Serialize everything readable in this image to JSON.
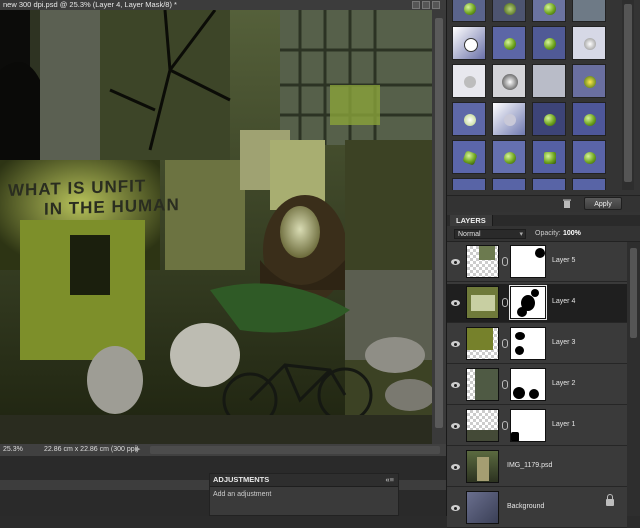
{
  "document": {
    "title": "new 300 dpi.psd @ 25.3% (Layer 4, Layer Mask/8) *",
    "zoom": "25.3%",
    "doc_size": "22.86 cm x 22.86 cm (300 ppi)",
    "canvas_text_line1": "WHAT IS UNFIT",
    "canvas_text_line2": "IN THE HUMAN"
  },
  "effects_panel": {
    "apply_label": "Apply",
    "trash_icon": "trash-icon"
  },
  "adjustments_panel": {
    "title": "ADJUSTMENTS",
    "hint": "Add an adjustment"
  },
  "layers_panel": {
    "tab_label": "LAYERS",
    "blend_mode": "Normal",
    "opacity_label": "Opacity:",
    "opacity_value": "100%",
    "layers": [
      {
        "name": "Layer 5",
        "active": false,
        "has_mask": true
      },
      {
        "name": "Layer 4",
        "active": true,
        "has_mask": true
      },
      {
        "name": "Layer 3",
        "active": false,
        "has_mask": true
      },
      {
        "name": "Layer 2",
        "active": false,
        "has_mask": true
      },
      {
        "name": "Layer 1",
        "active": false,
        "has_mask": true
      },
      {
        "name": "IMG_1179.psd",
        "active": false,
        "has_mask": false
      },
      {
        "name": "Background",
        "active": false,
        "has_mask": false,
        "locked": true
      }
    ]
  },
  "colors": {
    "panel_bg": "#343434",
    "active_layer": "#1f1f1f",
    "accent_green": "#7aa81f"
  }
}
